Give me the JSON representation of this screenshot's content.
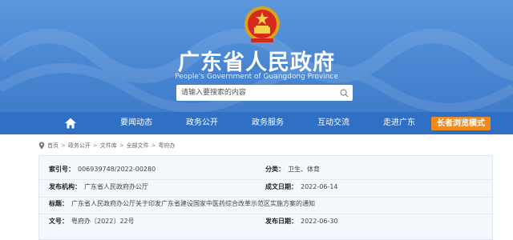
{
  "site": {
    "title": "广东省人民政府",
    "subtitle": "People's Government of Guangdong Province",
    "emblem_icon": "national-emblem-icon"
  },
  "search": {
    "placeholder": "请输入要搜索的内容",
    "button_icon": "search-icon"
  },
  "nav": {
    "home_icon": "home-icon",
    "items": [
      {
        "label": "要闻动态"
      },
      {
        "label": "政务公开"
      },
      {
        "label": "政务服务"
      },
      {
        "label": "互动交流"
      },
      {
        "label": "走进广东"
      }
    ],
    "elder_mode": "长者浏览模式"
  },
  "breadcrumb": {
    "icon": "location-pin-icon",
    "items": [
      "首页",
      "政务公开",
      "文件库",
      "全部文件",
      "粤府办"
    ],
    "separator": ">"
  },
  "info": {
    "index_label": "索引号：",
    "index_value": "006939748/2022-00280",
    "category_label": "分类：",
    "category_value": "卫生、体育",
    "issuer_label": "发布机构：",
    "issuer_value": "广东省人民政府办公厅",
    "date_label": "成文日期：",
    "date_value": "2022-06-14",
    "title_label": "标题：",
    "title_value": "广东省人民政府办公厅关于印发广东省建设国家中医药综合改革示范区实施方案的通知",
    "doc_label": "文号：",
    "doc_value": "粤府办〔2022〕22号",
    "publish_label": "发布日期：",
    "publish_value": "2022-06-30"
  },
  "colors": {
    "banner": "#4a87d3",
    "nav": "#2f6fc4",
    "elder_button": "#f08a1f",
    "panel": "#f4f7fb"
  }
}
